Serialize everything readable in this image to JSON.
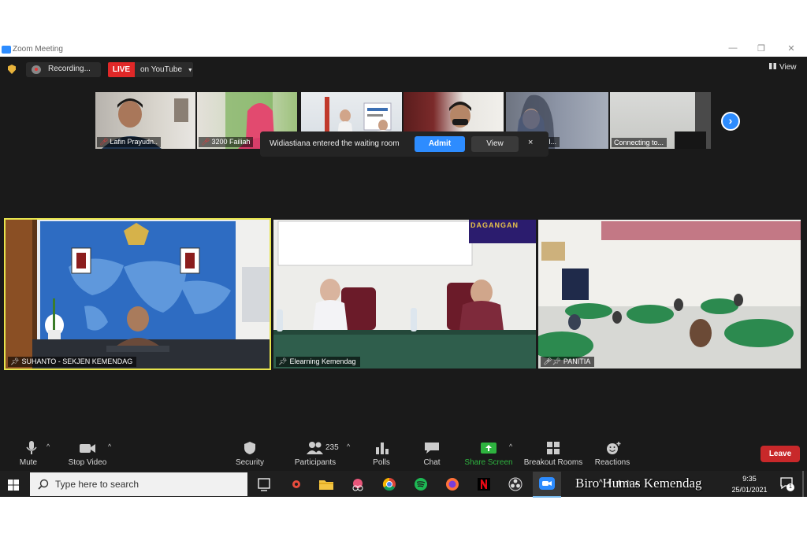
{
  "window": {
    "title": "Zoom Meeting"
  },
  "top_bar": {
    "recording_label": "Recording...",
    "live_badge": "LIVE",
    "live_target": "on YouTube",
    "view_label": "View"
  },
  "thumbnails": [
    {
      "name": "Lafin Prayudn..",
      "muted": true
    },
    {
      "name": "3200 Failiah",
      "muted": true
    },
    {
      "name": "",
      "muted": false
    },
    {
      "name": "",
      "muted": false
    },
    {
      "name": "A... herpil...",
      "muted": true
    },
    {
      "name": "Connecting to...",
      "muted": false
    }
  ],
  "waiting_toast": {
    "message": "Widiastiana entered the waiting room",
    "admit_label": "Admit",
    "view_label": "View",
    "close_glyph": "×"
  },
  "tiles": [
    {
      "name": "SUHANTO - SEKJEN KEMENDAG",
      "active_speaker": true
    },
    {
      "name": "Elearning Kemendag",
      "active_speaker": false
    },
    {
      "name": "PANITIA",
      "active_speaker": false
    }
  ],
  "banner_text": "DAGANGAN",
  "toolbar": {
    "mute": "Mute",
    "stop_video": "Stop Video",
    "security": "Security",
    "participants": "Participants",
    "participant_count": "235",
    "polls": "Polls",
    "chat": "Chat",
    "share_screen": "Share Screen",
    "breakout_rooms": "Breakout Rooms",
    "reactions": "Reactions",
    "leave": "Leave"
  },
  "taskbar": {
    "search_placeholder": "Type here to search",
    "time": "9:35",
    "date": "25/01/2021",
    "notification_count": "1"
  },
  "watermark": "Biro Humas Kemendag",
  "colors": {
    "zoom_blue": "#2d8cff",
    "leave_red": "#c8282a",
    "share_green": "#2eb33f",
    "active_speaker_border": "#e6e34d",
    "live_red": "#e02828"
  }
}
